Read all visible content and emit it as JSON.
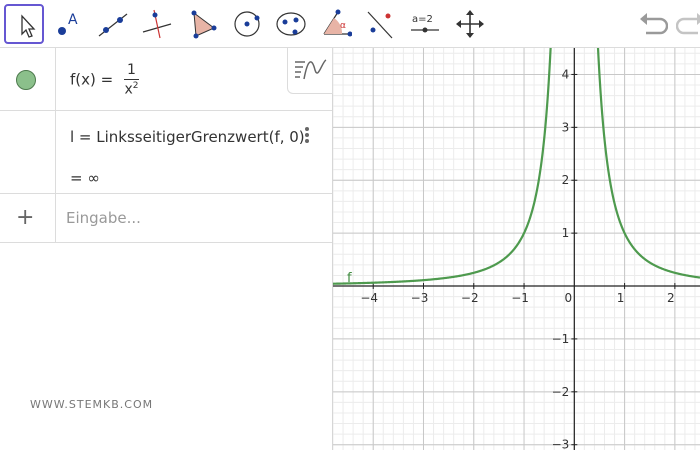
{
  "toolbar": {
    "tools": [
      {
        "id": "move",
        "icon": "arrow-cursor-icon",
        "active": true
      },
      {
        "id": "point",
        "icon": "point-icon",
        "label": "A"
      },
      {
        "id": "line",
        "icon": "line-icon"
      },
      {
        "id": "perpendicular",
        "icon": "perpendicular-line-icon"
      },
      {
        "id": "polygon",
        "icon": "polygon-icon"
      },
      {
        "id": "circle",
        "icon": "circle-icon"
      },
      {
        "id": "ellipse",
        "icon": "ellipse-icon"
      },
      {
        "id": "angle",
        "icon": "angle-icon",
        "label": "α"
      },
      {
        "id": "reflect",
        "icon": "reflect-icon"
      },
      {
        "id": "slider",
        "icon": "slider-icon",
        "label": "a=2"
      },
      {
        "id": "move-view",
        "icon": "move-graphics-icon"
      }
    ],
    "undo_icon": "undo-icon",
    "redo_icon": "redo-icon"
  },
  "algebra": {
    "row1": {
      "lhs": "f(x)",
      "eq": "=",
      "num": "1",
      "den": "x",
      "den_exp": "2"
    },
    "row2": {
      "expr": "l = LinksseitigerGrenzwert(f, 0)",
      "result": "=  ∞"
    },
    "input": {
      "plus": "+",
      "placeholder": "Eingabe..."
    },
    "style_icon": "graph-style-icon",
    "watermark": "WWW.STEMKB.COM"
  },
  "chart_data": {
    "type": "line",
    "function": "f(x) = 1/x^2",
    "series": [
      {
        "name": "f",
        "color": "#4e9a4e"
      }
    ],
    "xlabel": "",
    "ylabel": "",
    "x_ticks": [
      -4,
      -3,
      -2,
      -1,
      0,
      1,
      2
    ],
    "y_ticks": [
      4,
      3,
      2,
      1,
      -1,
      -2,
      -3
    ],
    "xlim": [
      -4.8,
      2.5
    ],
    "ylim": [
      -3.1,
      4.5
    ],
    "grid": true,
    "colors": {
      "curve": "#4e9a4e",
      "axis": "#222222",
      "grid_major": "#c8c8c8",
      "grid_minor": "#ececec"
    }
  }
}
